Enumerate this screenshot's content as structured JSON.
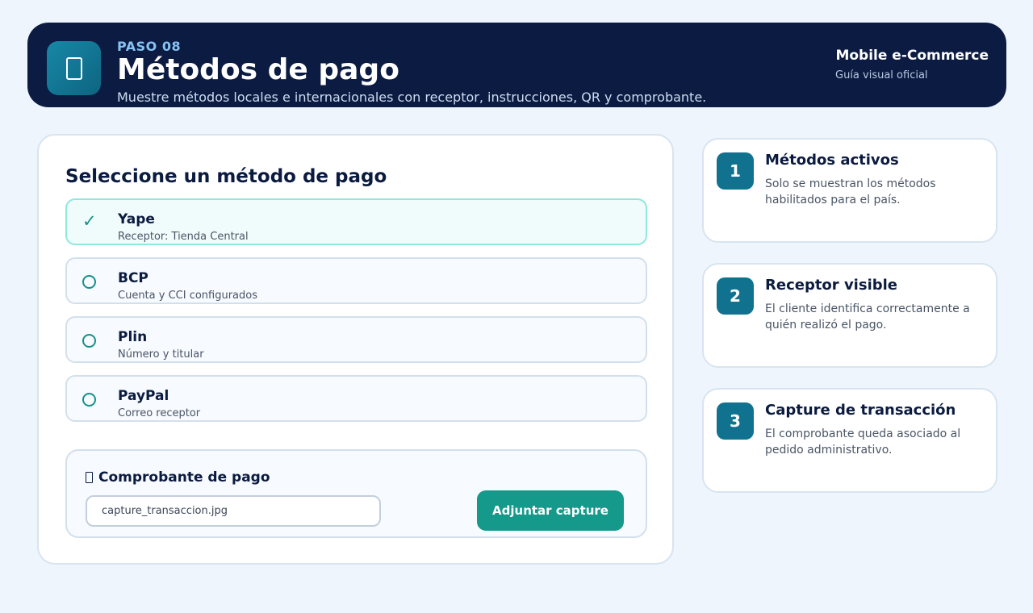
{
  "header": {
    "icon": "payment-icon",
    "step": "PASO 08",
    "title": "Métodos de pago",
    "subtitle": "Muestre métodos locales e internacionales con receptor, instrucciones, QR y comprobante.",
    "brand": "Mobile e-Commerce",
    "brand_sub": "Guía visual oficial"
  },
  "main": {
    "title": "Seleccione un método de pago",
    "methods": [
      {
        "name": "Yape",
        "desc": "Receptor: Tienda Central",
        "selected": true
      },
      {
        "name": "BCP",
        "desc": "Cuenta y CCI configurados",
        "selected": false
      },
      {
        "name": "Plin",
        "desc": "Número y titular",
        "selected": false
      },
      {
        "name": "PayPal",
        "desc": "Correo receptor",
        "selected": false
      }
    ],
    "check_glyph": "✓",
    "proof": {
      "title": "Comprobante de pago",
      "file_value": "capture_transaccion.jpg",
      "button": "Adjuntar capture"
    }
  },
  "steps": [
    {
      "num": "1",
      "title": "Métodos activos",
      "desc": "Solo se muestran los métodos habilitados para el país."
    },
    {
      "num": "2",
      "title": "Receptor visible",
      "desc": "El cliente identifica correctamente a quién realizó el pago."
    },
    {
      "num": "3",
      "title": "Capture de transacción",
      "desc": "El comprobante queda asociado al pedido administrativo."
    }
  ],
  "colors": {
    "header_bg": "#0b1b42",
    "accent": "#14998a",
    "step_badge": "#10728f",
    "page_bg": "#eef5fc"
  }
}
